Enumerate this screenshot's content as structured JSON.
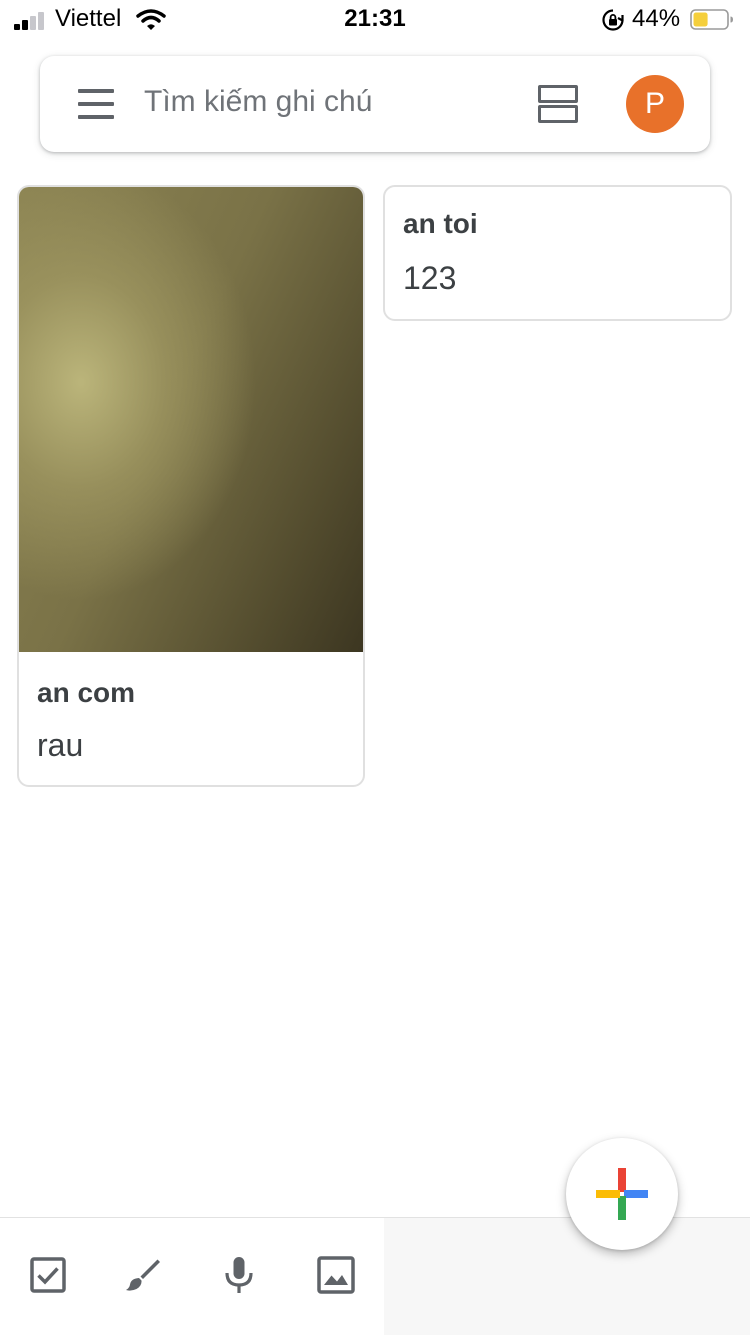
{
  "status_bar": {
    "carrier": "Viettel",
    "time": "21:31",
    "battery_percent": "44%",
    "battery_level": 0.44,
    "battery_color": "#f5cf3c"
  },
  "search_bar": {
    "menu_icon": "hamburger-menu-icon",
    "placeholder": "Tìm kiếm ghi chú",
    "layout_icon": "list-view-icon",
    "avatar_letter": "P",
    "avatar_color": "#e8712a"
  },
  "notes": [
    {
      "title": "an com",
      "body": "rau",
      "has_image": true
    },
    {
      "title": "an toi",
      "body": "123",
      "has_image": false
    }
  ],
  "bottom_bar": {
    "tools": [
      {
        "name": "new-list-button",
        "icon": "checkbox-icon"
      },
      {
        "name": "new-drawing-button",
        "icon": "brush-icon"
      },
      {
        "name": "new-audio-button",
        "icon": "microphone-icon"
      },
      {
        "name": "new-image-button",
        "icon": "image-icon"
      }
    ],
    "fab_icon": "plus-icon",
    "fab_colors": [
      "#ea4335",
      "#4285f4",
      "#34a853",
      "#fbbc05"
    ]
  }
}
